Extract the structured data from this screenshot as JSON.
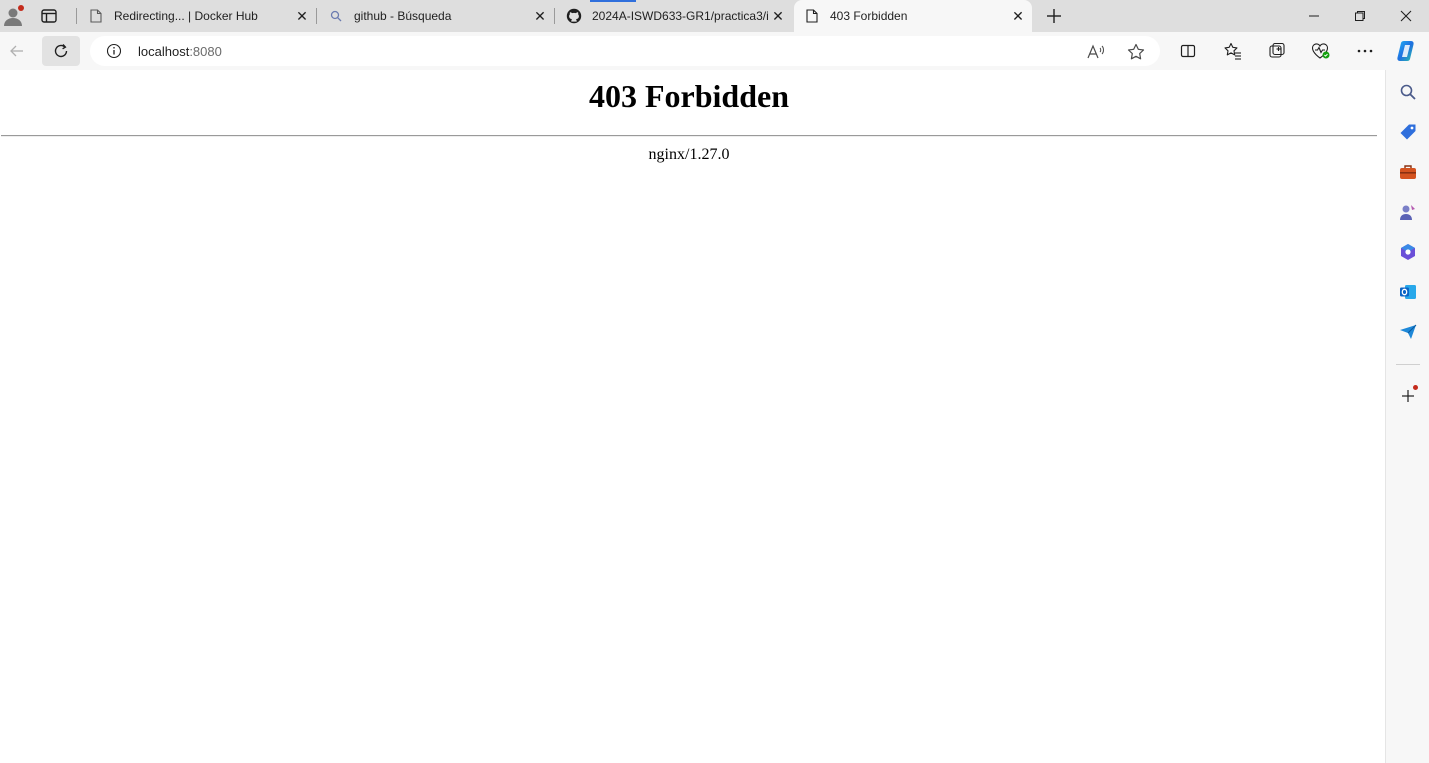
{
  "tabs": [
    {
      "title": "Redirecting... | Docker Hub",
      "favicon": "page-icon"
    },
    {
      "title": "github - Búsqueda",
      "favicon": "search-icon"
    },
    {
      "title": "2024A-ISWD633-GR1/practica3/i",
      "favicon": "github-icon"
    },
    {
      "title": "403 Forbidden",
      "favicon": "page-icon",
      "active": true
    }
  ],
  "address_bar": {
    "host": "localhost",
    "port": ":8080"
  },
  "page": {
    "heading": "403 Forbidden",
    "server": "nginx/1.27.0"
  },
  "colors": {
    "tab_strip": "#dedede",
    "toolbar": "#f7f7f7",
    "accent": "#2f6fdc",
    "notification_dot": "#c42b1c"
  }
}
